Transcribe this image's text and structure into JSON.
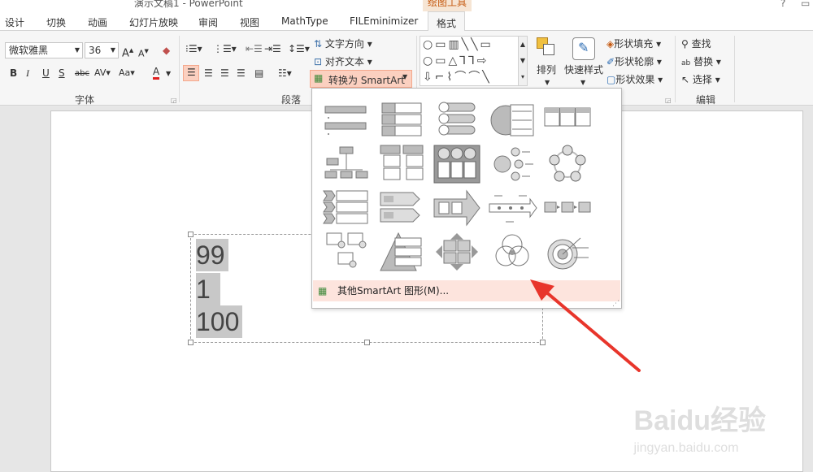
{
  "window": {
    "title": "演示文稿1 - PowerPoint",
    "context_tab": "绘图工具",
    "help": "?",
    "restore": "▭"
  },
  "tabs": [
    "设计",
    "切换",
    "动画",
    "幻灯片放映",
    "审阅",
    "视图",
    "MathType",
    "FILEminimizer",
    "格式"
  ],
  "font_group": {
    "font_name": "微软雅黑",
    "font_size": "36",
    "label": "字体"
  },
  "paragraph_group": {
    "label": "段落",
    "text_direction": "文字方向",
    "align_text": "对齐文本",
    "convert_smartart": "转换为 SmartArt"
  },
  "drawing_group": {
    "arrange": "排列",
    "quick_styles": "快速样式",
    "shape_fill": "形状填充",
    "shape_outline": "形状轮廓",
    "shape_effects": "形状效果"
  },
  "editing_group": {
    "label": "编辑",
    "find": "查找",
    "replace": "替换",
    "select": "选择"
  },
  "slide": {
    "lines": [
      "99",
      "1",
      "100"
    ]
  },
  "smartart_menu": {
    "more_label": "其他SmartArt 图形(M)..."
  },
  "watermark": {
    "brand": "Baidu经验",
    "url": "jingyan.baidu.com"
  },
  "colors": {
    "accent": "#c55a11",
    "highlight": "#fde4dd",
    "arrow": "#e8352b"
  }
}
